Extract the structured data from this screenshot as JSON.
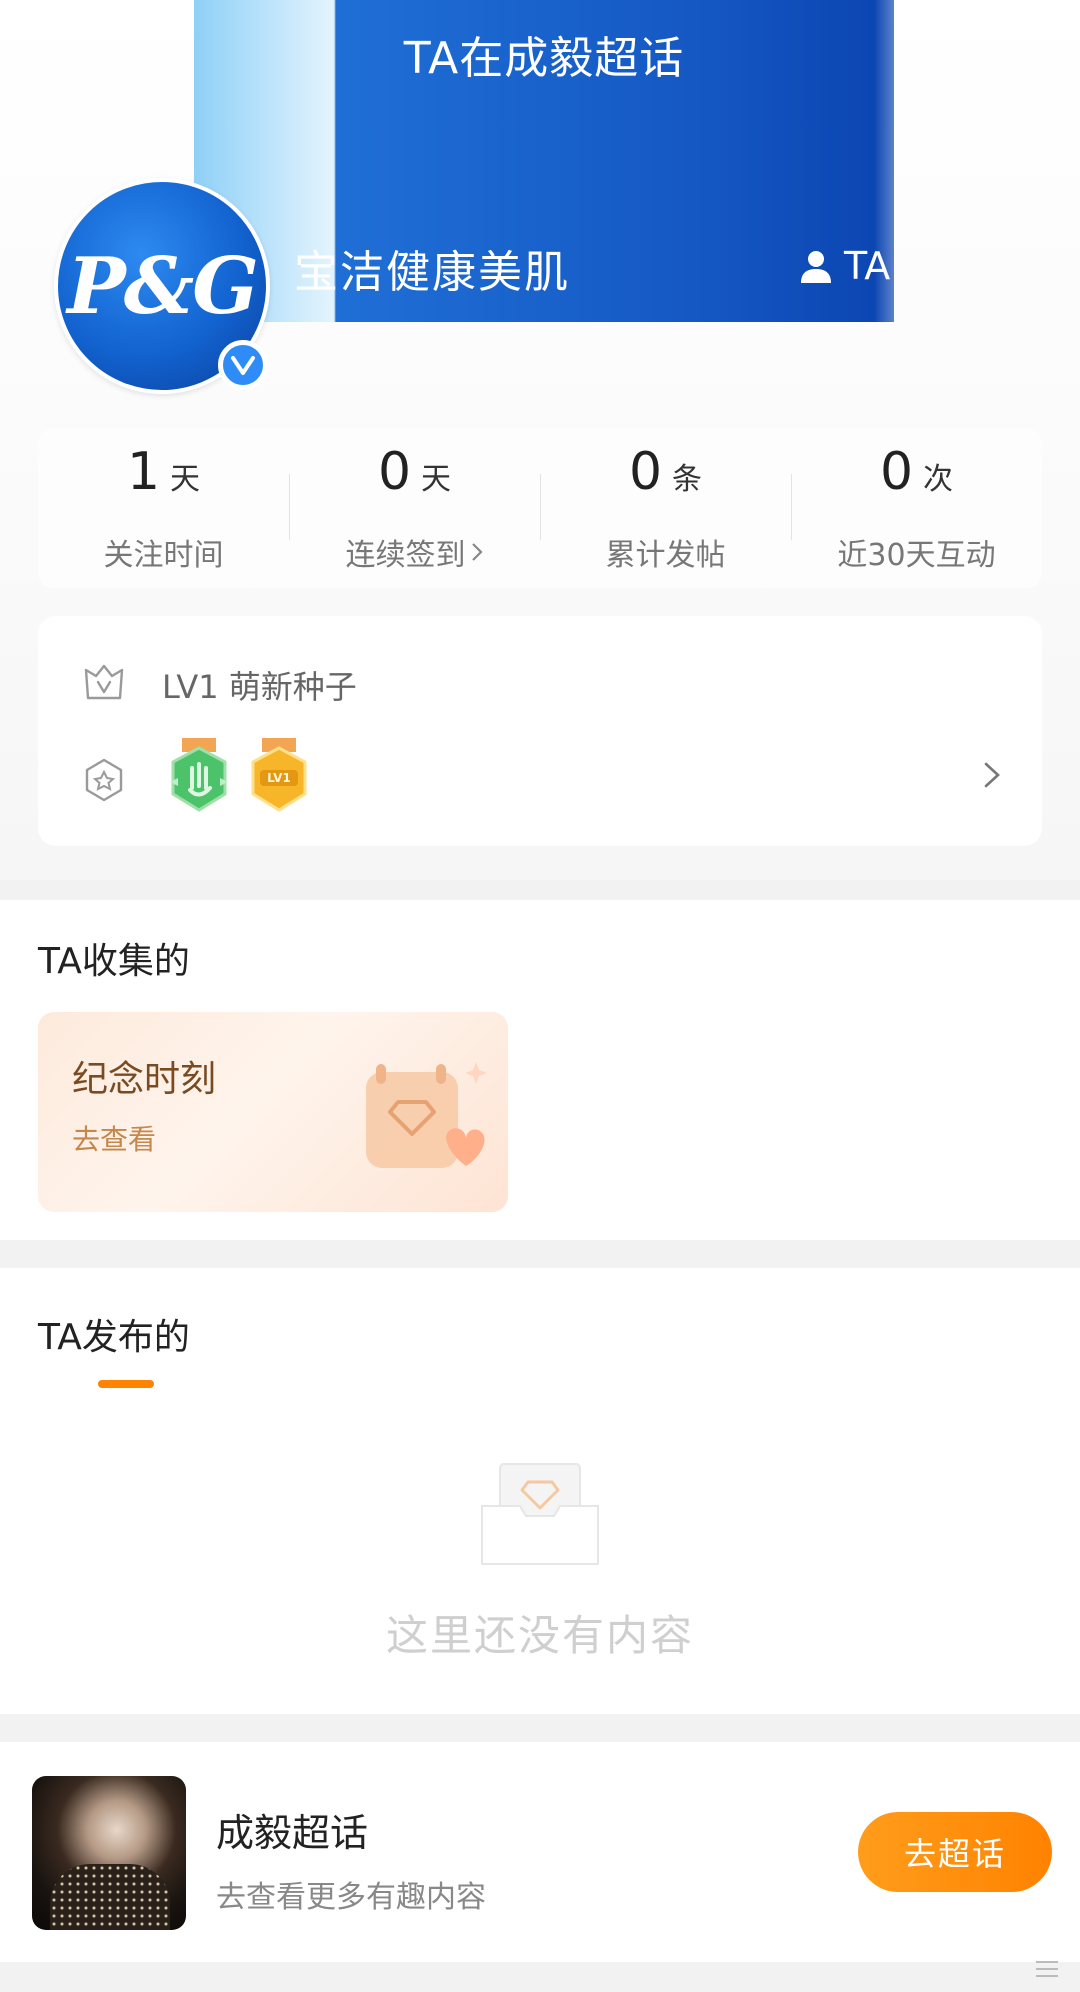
{
  "banner": {
    "title": "TA在成毅超话",
    "username": "宝洁健康美肌",
    "user_tag": "TA"
  },
  "avatar": {
    "logo_text": "P&G",
    "verified_icon": "verified-v-badge",
    "accent": "#2f8cf6"
  },
  "stats": [
    {
      "value": "1",
      "unit": "天",
      "label": "关注时间",
      "has_chevron": false
    },
    {
      "value": "0",
      "unit": "天",
      "label": "连续签到",
      "has_chevron": true
    },
    {
      "value": "0",
      "unit": "条",
      "label": "累计发帖",
      "has_chevron": false
    },
    {
      "value": "0",
      "unit": "次",
      "label": "近30天互动",
      "has_chevron": false
    }
  ],
  "level": {
    "label": "LV1 萌新种子",
    "medals": [
      "green-hand-medal",
      "gold-lv1-medal"
    ],
    "medal_lv_text": "LV1"
  },
  "collected": {
    "title": "TA收集的",
    "card_title": "纪念时刻",
    "card_link": "去查看"
  },
  "posts": {
    "title": "TA发布的",
    "empty_text": "这里还没有内容",
    "accent": "#ff8200"
  },
  "topic": {
    "title": "成毅超话",
    "subtitle": "去查看更多有趣内容",
    "button": "去超话"
  }
}
